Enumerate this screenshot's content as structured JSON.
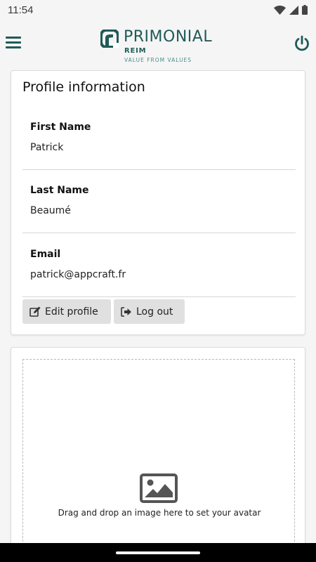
{
  "status_bar": {
    "time": "11:54",
    "icons": [
      "wifi-icon",
      "cell-signal-icon",
      "battery-icon"
    ]
  },
  "header": {
    "brand_name": "PRIMONIAL",
    "brand_sub": "REIM",
    "tagline": "VALUE FROM VALUES",
    "menu_icon": "hamburger-menu-icon",
    "power_icon": "power-icon",
    "brand_color": "#1f5b57"
  },
  "profile": {
    "title": "Profile information",
    "fields": [
      {
        "label": "First Name",
        "value": "Patrick"
      },
      {
        "label": "Last Name",
        "value": "Beaumé"
      },
      {
        "label": "Email",
        "value": "patrick@appcraft.fr"
      }
    ],
    "edit_button": "Edit profile",
    "logout_button": "Log out"
  },
  "avatar": {
    "drop_text": "Drag and drop an image here to set your avatar",
    "icon": "image-icon"
  }
}
